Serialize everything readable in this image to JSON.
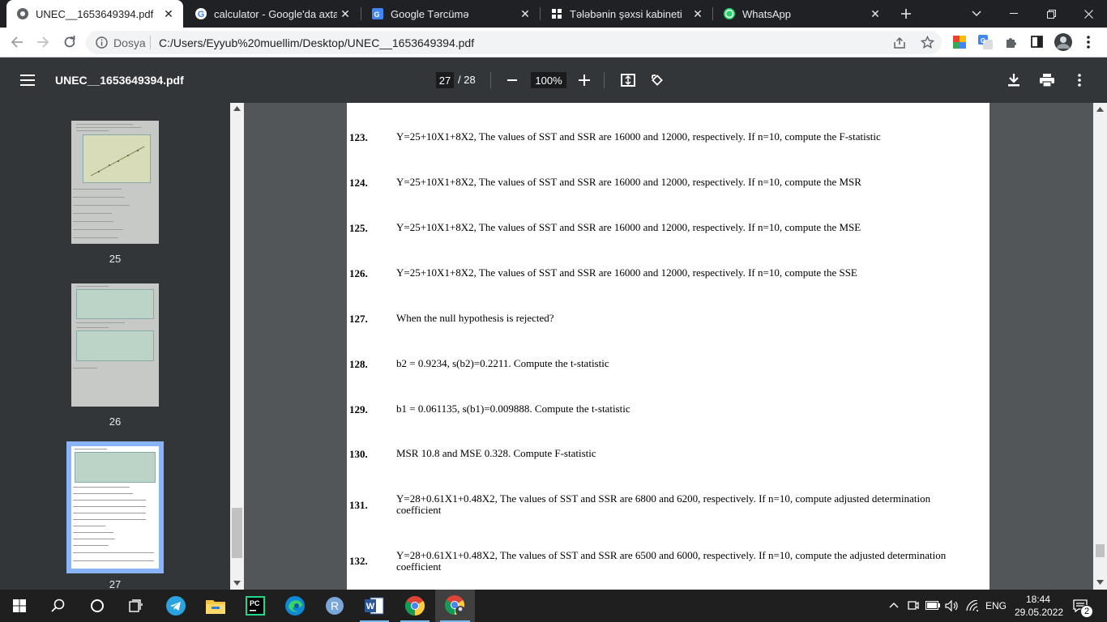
{
  "tabs": [
    {
      "title": "UNEC__1653649394.pdf",
      "icon": "globe-icon",
      "active": true
    },
    {
      "title": "calculator - Google'da axtarış",
      "icon": "google-icon"
    },
    {
      "title": "Google Tərcümə",
      "icon": "google-translate-icon"
    },
    {
      "title": "Tələbənin şəxsi kabineti",
      "icon": "unec-icon"
    },
    {
      "title": "WhatsApp",
      "icon": "whatsapp-icon"
    }
  ],
  "address": {
    "security_label": "Dosya",
    "url": "C:/Users/Eyyub%20muellim/Desktop/UNEC__1653649394.pdf"
  },
  "pdf_toolbar": {
    "file_name": "UNEC__1653649394.pdf",
    "current_page": "27",
    "total_pages": "/ 28",
    "zoom": "100%"
  },
  "thumbnails": [
    {
      "page": "25"
    },
    {
      "page": "26"
    },
    {
      "page": "27",
      "selected": true
    }
  ],
  "questions": [
    {
      "num": "123.",
      "text": "Y=25+10X1+8X2, The values of SST and SSR are 16000 and 12000, respectively. If n=10, compute the F-statistic"
    },
    {
      "num": "124.",
      "text": "Y=25+10X1+8X2, The values of SST and SSR are 16000 and 12000, respectively. If n=10, compute the MSR"
    },
    {
      "num": "125.",
      "text": "Y=25+10X1+8X2, The values of SST and SSR are 16000 and 12000, respectively. If n=10, compute the MSE"
    },
    {
      "num": "126.",
      "text": "Y=25+10X1+8X2, The values of SST and SSR are 16000 and 12000, respectively. If n=10, compute the SSE"
    },
    {
      "num": "127.",
      "text": "When the null hypothesis is rejected?"
    },
    {
      "num": "128.",
      "text": "b2 =  0.9234, s(b2)=0.2211. Compute the t-statistic"
    },
    {
      "num": "129.",
      "text": "b1 =  0.061135, s(b1)=0.009888. Compute the t-statistic"
    },
    {
      "num": "130.",
      "text": "MSR  10.8 and MSE 0.328. Compute F-statistic"
    },
    {
      "num": "131.",
      "text": "Y=28+0.61X1+0.48X2, The values of SST and SSR are 6800 and 6200, respectively. If n=10, compute adjusted determination coefficient"
    },
    {
      "num": "132.",
      "text": "Y=28+0.61X1+0.48X2, The values of SST and SSR are 6500 and 6000, respectively. If n=10, compute the adjusted determination coefficient"
    }
  ],
  "taskbar": {
    "apps": [
      "start-icon",
      "search-icon",
      "cortana-icon",
      "task-view-icon",
      "telegram-icon",
      "file-explorer-icon",
      "pycharm-icon",
      "edge-icon",
      "r-icon",
      "word-icon",
      "chrome-icon",
      "chrome-profile-icon"
    ],
    "language": "ENG",
    "time": "18:44",
    "date": "29.05.2022",
    "notifications": "2"
  },
  "colors": {
    "accent": "#8ab4f8",
    "toolbar": "#323639",
    "viewer_bg": "#525659"
  }
}
